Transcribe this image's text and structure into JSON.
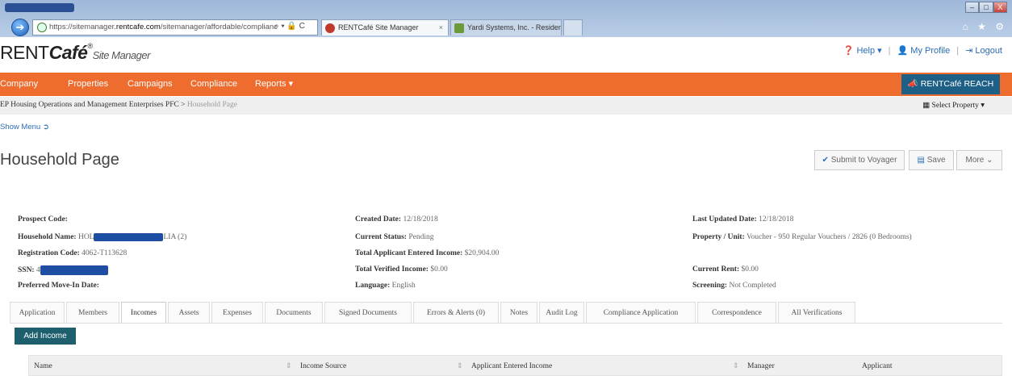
{
  "browser": {
    "url_prefix": "https://sitemanager.",
    "url_domain": "rentcafe.com",
    "url_path": "/sitemanager/affordable/complianc",
    "url_controls": "⌕ ▾ 🔒 C",
    "tabs": [
      {
        "label": "RENTCafé Site Manager",
        "close": "×"
      },
      {
        "label": "Yardi Systems, Inc. - Resident"
      }
    ],
    "window_controls": [
      "–",
      "□",
      "X"
    ],
    "right_icons": "⌂ ★ ⚙"
  },
  "header": {
    "logo_main": "RENT",
    "logo_cafe": "Café",
    "logo_reg": "®",
    "logo_sub": "Site Manager",
    "help": "Help ▾",
    "profile": "My Profile",
    "logout": "Logout"
  },
  "nav": {
    "items": [
      "Company",
      "Properties",
      "Campaigns",
      "Compliance",
      "Reports ▾"
    ],
    "reach": "RENTCafé REACH"
  },
  "breadcrumb": {
    "parent": "EP Housing Operations and Management Enterprises PFC >",
    "current": "Household Page",
    "select_property": "Select Property ▾"
  },
  "show_menu": "Show Menu",
  "page": {
    "title": "Household Page",
    "buttons": {
      "submit": "Submit to Voyager",
      "save": "Save",
      "more": "More"
    }
  },
  "fields": {
    "prospect_code": {
      "label": "Prospect Code:",
      "value": ""
    },
    "household_name": {
      "label": "Household Name:",
      "value_prefix": "HOL",
      "value_suffix": "LIA (2)"
    },
    "registration_code": {
      "label": "Registration Code:",
      "value": "4062-T113628"
    },
    "ssn": {
      "label": "SSN:",
      "value_prefix": "4"
    },
    "preferred_move_in": {
      "label": "Preferred Move-In Date:",
      "value": ""
    },
    "created_date": {
      "label": "Created Date:",
      "value": "12/18/2018"
    },
    "current_status": {
      "label": "Current Status:",
      "value": "Pending"
    },
    "total_applicant_income": {
      "label": "Total Applicant Entered Income:",
      "value": "$20,904.00"
    },
    "total_verified_income": {
      "label": "Total Verified Income:",
      "value": "$0.00"
    },
    "language": {
      "label": "Language:",
      "value": "English"
    },
    "last_updated": {
      "label": "Last Updated Date:",
      "value": "12/18/2018"
    },
    "property_unit": {
      "label": "Property / Unit:",
      "value": "Voucher - 950 Regular Vouchers / 2826 (0 Bedrooms)"
    },
    "current_rent": {
      "label": "Current Rent:",
      "value": "$0.00"
    },
    "screening": {
      "label": "Screening:",
      "value": "Not Completed"
    }
  },
  "tabs": [
    "Application",
    "Members",
    "Incomes",
    "Assets",
    "Expenses",
    "Documents",
    "Signed Documents",
    "Errors & Alerts (0)",
    "Notes",
    "Audit Log",
    "Compliance Application",
    "Correspondence",
    "All Verifications"
  ],
  "active_tab": "Incomes",
  "add_income": "Add Income",
  "grid": {
    "columns": [
      "Name",
      "Income Source",
      "Applicant Entered Income",
      "Manager",
      "Applicant"
    ]
  },
  "colors": {
    "nav_orange": "#ef6c2f",
    "reach_blue": "#1e5f86",
    "link_blue": "#2a6db8",
    "redaction": "#1e4ea3"
  }
}
